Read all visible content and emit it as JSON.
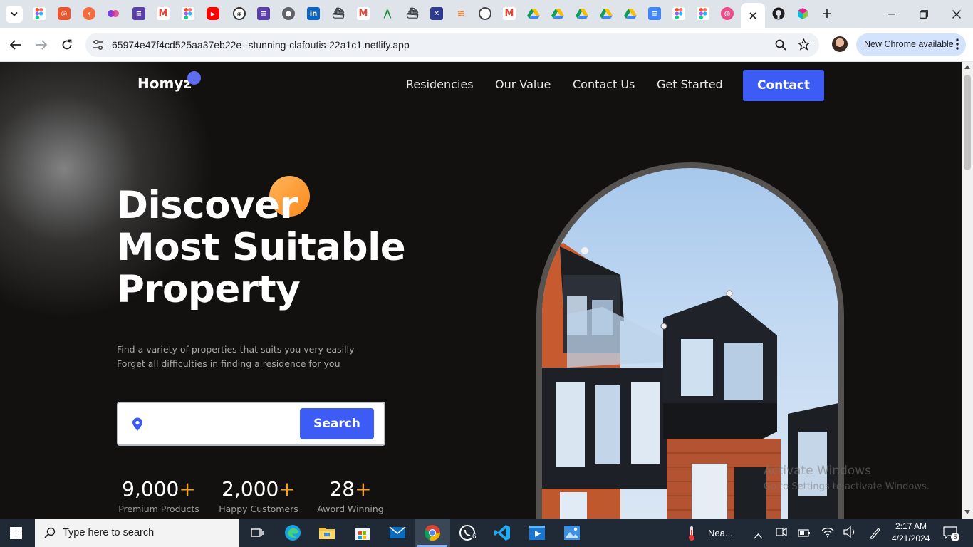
{
  "browser": {
    "address_bar": {
      "url": "65974e47f4cd525aa37eb22e--stunning-clafoutis-22a1c1.netlify.app"
    },
    "update_button": {
      "label": "New Chrome available"
    }
  },
  "site": {
    "logo": "Homyz",
    "nav": {
      "residencies": "Residencies",
      "our_value": "Our Value",
      "contact_us": "Contact Us",
      "get_started": "Get Started",
      "contact_button": "Contact"
    },
    "hero": {
      "title_line1": "Discover",
      "title_line2": "Most Suitable",
      "title_line3": "Property",
      "subtitle_line1": "Find a variety of properties that suits you very easilly",
      "subtitle_line2": "Forget all difficulties in finding a residence for you",
      "search_button": "Search",
      "search_input_value": ""
    },
    "stats": [
      {
        "number": "9,000",
        "plus": "+",
        "label": "Premium Products"
      },
      {
        "number": "2,000",
        "plus": "+",
        "label": "Happy Customers"
      },
      {
        "number": "28",
        "plus": "+",
        "label": "Aword Winning"
      }
    ]
  },
  "os": {
    "watermark_title": "Activate Windows",
    "watermark_sub": "Go to Settings to activate Windows.",
    "taskbar": {
      "search_placeholder": "Type here to search",
      "whatsapp_badge": "6",
      "weather_text": "Nea...",
      "clock_time": "2:17 AM",
      "clock_date": "4/21/2024",
      "notification_count": "5"
    }
  },
  "colors": {
    "accent_blue": "#3d5cf5",
    "accent_orange": "#f7a123",
    "page_bg": "#131110"
  },
  "icons": [
    "tab-search-icon",
    "figma-icon",
    "youtube-icon",
    "linkedin-icon",
    "gmail-icon",
    "google-drive-icon",
    "github-icon",
    "close-icon",
    "new-tab-icon",
    "back-icon",
    "forward-icon",
    "reload-icon",
    "site-info-icon",
    "zoom-icon",
    "bookmark-star-icon",
    "location-pin-icon",
    "windows-start-icon"
  ]
}
